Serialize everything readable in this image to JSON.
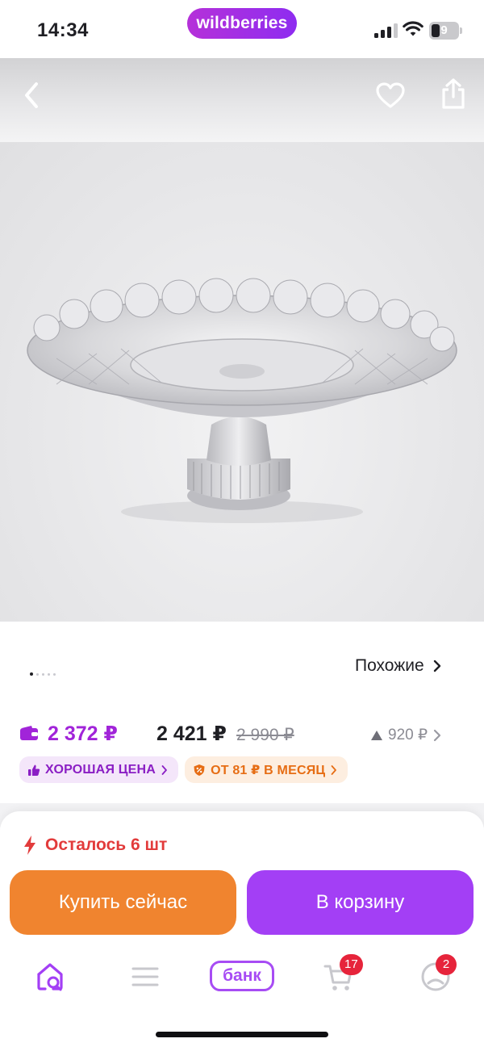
{
  "status_bar": {
    "time": "14:34",
    "brand": "wildberries",
    "battery": "9"
  },
  "header": {
    "back_icon": "chevron-left-icon",
    "favorite_icon": "heart-icon",
    "share_icon": "share-icon"
  },
  "gallery": {
    "image_description_icon": "cake-stand-image",
    "page_count": 5,
    "active_index": 0,
    "similar_label": "Похожие"
  },
  "price": {
    "wallet_price": "2 372 ₽",
    "regular_price": "2 421 ₽",
    "old_price": "2 990 ₽",
    "delta": "920 ₽"
  },
  "badges": {
    "good_price": "ХОРОШАЯ ЦЕНА",
    "installment": "ОТ 81 ₽ В МЕСЯЦ"
  },
  "stock": {
    "text": "Осталось 6 шт"
  },
  "actions": {
    "buy_now": "Купить сейчас",
    "add_to_cart": "В корзину"
  },
  "tabbar": {
    "bank_label": "банк",
    "cart_count": "17",
    "profile_count": "2"
  },
  "colors": {
    "accent_purple": "#a33ff5",
    "orange": "#f0842f",
    "wallet_purple": "#a124d9",
    "alert_red": "#e23b3b",
    "badge_red": "#e6243b"
  }
}
